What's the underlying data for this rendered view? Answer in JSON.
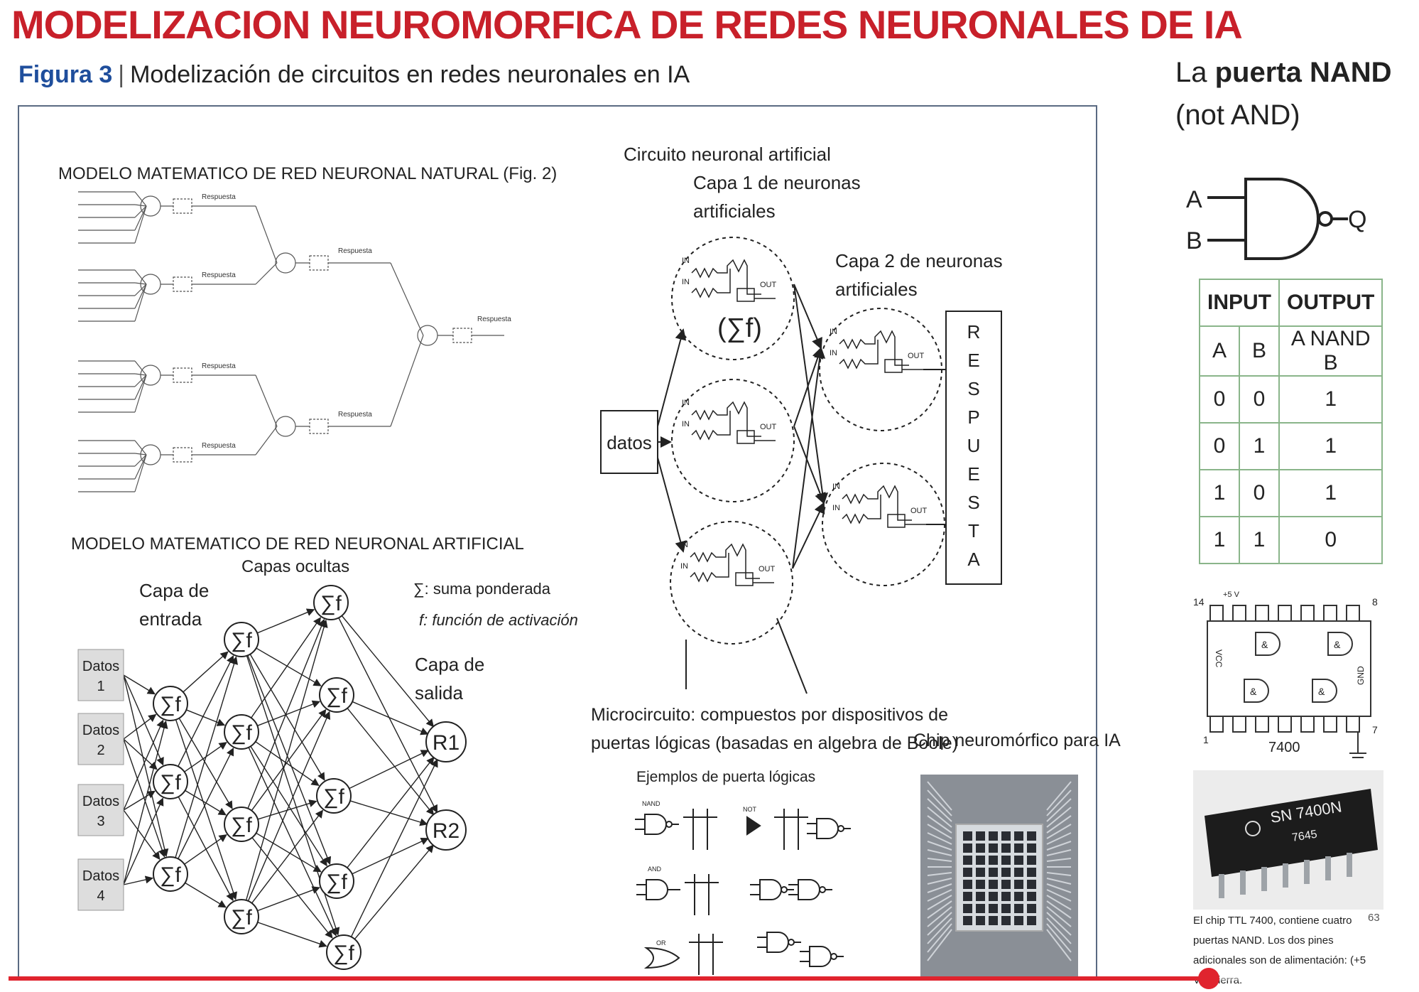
{
  "slide": {
    "title": "MODELIZACION NEUROMORFICA DE REDES NEURONALES DE IA",
    "figure_label": "Figura 3",
    "figure_sep": "|",
    "figure_caption": "Modelización de circuitos en redes neuronales en IA"
  },
  "natural_model": {
    "title": "MODELO MATEMATICO DE RED NEURONAL NATURAL (Fig. 2)",
    "response_label": "Respuesta"
  },
  "artificial_model": {
    "title": "MODELO MATEMATICO DE RED NEURONAL ARTIFICIAL",
    "hidden_layers": "Capas ocultas",
    "input_layer_1": "Capa de",
    "input_layer_2": "entrada",
    "output_layer_1": "Capa de",
    "output_layer_2": "salida",
    "sum_legend": "∑: suma ponderada",
    "f_legend": "f: función de activación",
    "inputs": [
      {
        "l1": "Datos",
        "l2": "1"
      },
      {
        "l1": "Datos",
        "l2": "2"
      },
      {
        "l1": "Datos",
        "l2": "3"
      },
      {
        "l1": "Datos",
        "l2": "4"
      }
    ],
    "node_label": "∑f",
    "outputs": [
      "R1",
      "R2"
    ]
  },
  "neural_circuit": {
    "title": "Circuito neuronal artificial",
    "layer1_1": "Capa 1 de neuronas",
    "layer1_2": "artificiales",
    "layer2_1": "Capa 2 de neuronas",
    "layer2_2": "artificiales",
    "sigma_f": "(∑f)",
    "data_box": "datos",
    "response_letters": [
      "R",
      "E",
      "S",
      "P",
      "U",
      "E",
      "S",
      "T",
      "A"
    ],
    "in_label": "IN",
    "out_label": "OUT"
  },
  "microcircuit": {
    "line1": "Microcircuito: compuestos por dispositivos de",
    "line2": "puertas lógicas (basadas en algebra de Boole)",
    "examples": "Ejemplos de puerta lógicas",
    "gate_labels": [
      "NAND",
      "NOT",
      "AND",
      "OR"
    ]
  },
  "chip": {
    "title": "Chip neuromórfico para IA"
  },
  "nand": {
    "title_1": "La ",
    "title_bold": "puerta NAND",
    "title_2": "(not AND)",
    "input_a": "A",
    "input_b": "B",
    "output_q": "Q",
    "table_headers": [
      "INPUT",
      "OUTPUT"
    ],
    "table_subheaders": [
      "A",
      "B",
      "A NAND B"
    ],
    "table_rows": [
      [
        "0",
        "0",
        "1"
      ],
      [
        "0",
        "1",
        "1"
      ],
      [
        "1",
        "0",
        "1"
      ],
      [
        "1",
        "1",
        "0"
      ]
    ],
    "ic_pin_14": "14",
    "ic_pin_8": "8",
    "ic_pin_1": "1",
    "ic_pin_7": "7",
    "ic_vcc": "+5 V",
    "ic_vcc_label": "VCC",
    "ic_gnd_label": "GND",
    "ic_gate_symbol": "&",
    "ic_name": "7400",
    "chip_marking_1": "SN 7400N",
    "chip_marking_2": "7645",
    "desc_1": "El chip TTL 7400, contiene cuatro",
    "desc_2": "puertas NAND. Los dos pines",
    "desc_3": "adicionales son de alimentación: (+5",
    "desc_4": "V) y tierra.",
    "page_num": "63"
  },
  "player": {
    "progress": 0.856,
    "colors": {
      "accent": "#e0242e"
    }
  }
}
